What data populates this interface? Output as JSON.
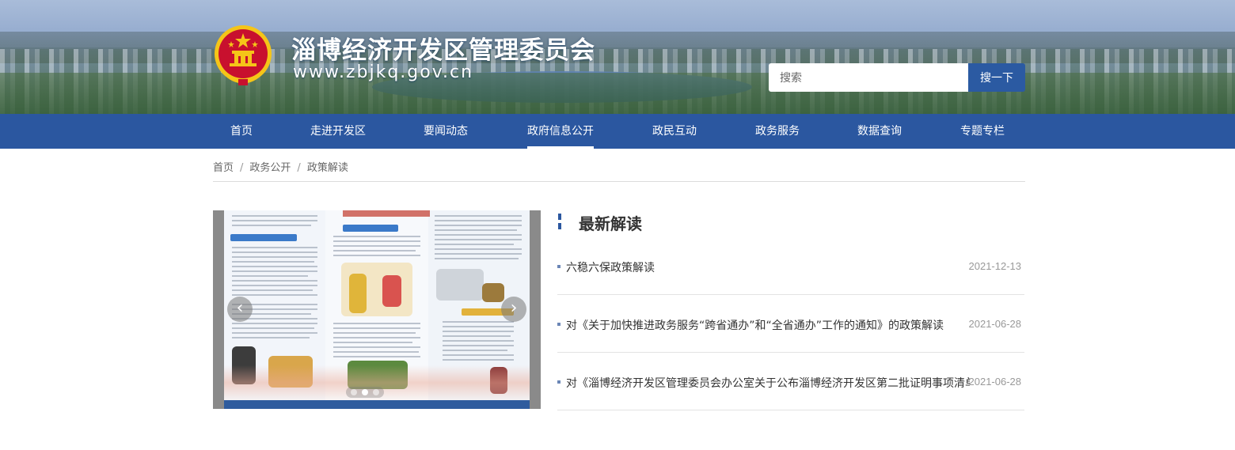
{
  "header": {
    "site_title": "淄博经济开发区管理委员会",
    "site_url": "www.zbjkq.gov.cn",
    "search_placeholder": "搜索",
    "search_button": "搜一下"
  },
  "nav": {
    "items": [
      {
        "label": "首页"
      },
      {
        "label": "走进开发区"
      },
      {
        "label": "要闻动态"
      },
      {
        "label": "政府信息公开",
        "active": true
      },
      {
        "label": "政民互动"
      },
      {
        "label": "政务服务"
      },
      {
        "label": "数据查询"
      },
      {
        "label": "专题专栏"
      }
    ]
  },
  "breadcrumb": {
    "items": [
      "首页",
      "政务公开",
      "政策解读"
    ],
    "separator": "/"
  },
  "carousel": {
    "prev_icon": "‹",
    "next_icon": "›",
    "slide_count": 3,
    "active_slide": 1
  },
  "latest": {
    "title": "最新解读",
    "items": [
      {
        "title": "六稳六保政策解读",
        "date": "2021-12-13"
      },
      {
        "title": "对《关于加快推进政务服务“跨省通办”和“全省通办”工作的通知》的政策解读",
        "date": "2021-06-28"
      },
      {
        "title": "对《淄博经济开发区管理委员会办公室关于公布淄博经济开发区第二批证明事项清单的通知》的政策解读",
        "date": "2021-06-28"
      }
    ]
  },
  "colors": {
    "nav_bg": "#2b57a0",
    "search_button_bg": "#2b5aa2",
    "emblem_red": "#c8102e",
    "emblem_gold": "#f5c518"
  }
}
